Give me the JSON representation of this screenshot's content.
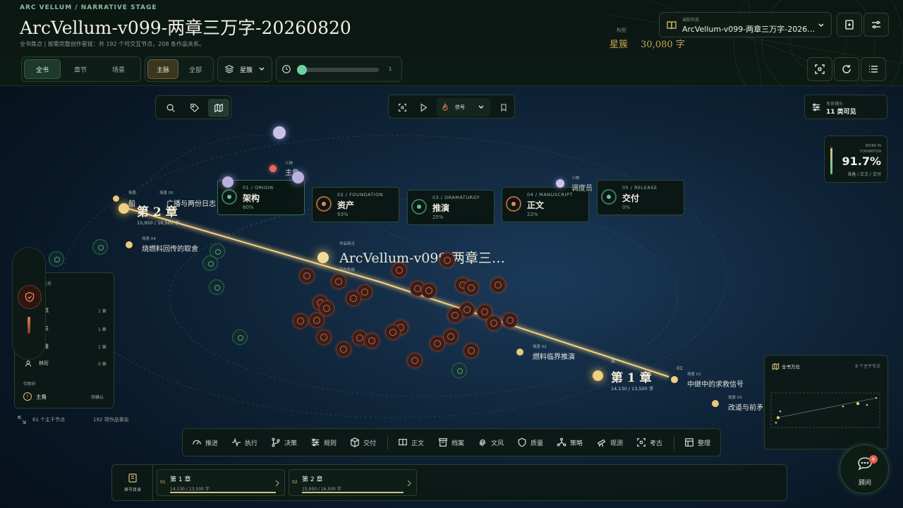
{
  "header": {
    "eyebrow": "ARC VELLUM / NARRATIVE STAGE",
    "title": "ArcVellum-v099-两章三万字-20260820",
    "subtitle": "全书焦点 | 按需完整创作星链：共 192 个可交互节点，208 条作品关系。",
    "scope_tabs": [
      "全书",
      "章节",
      "场景"
    ],
    "scope_active": "全书",
    "line_tabs": [
      "主脉",
      "全部"
    ],
    "line_active": "主脉",
    "layer_label": "星簇",
    "slider_value": "1",
    "meta_label": "构型",
    "meta_value_a": "星簇",
    "meta_value_b": "30,080 字",
    "work_label": "当前作品",
    "work_value": "ArcVellum-v099-两章三万字-2026…"
  },
  "canvas_toolbar": {
    "mode_label": "信号"
  },
  "relations_panel": {
    "label": "关系镜头",
    "value": "11 类可见"
  },
  "formation": {
    "label_a": "WORK IN",
    "label_b": "FORMATION",
    "value": "91.7%",
    "caption": "准备 / 正文 / 交付",
    "progress": 0.917
  },
  "stages": [
    {
      "code": "01 / ORIGIN",
      "name": "架构",
      "pct": "60%"
    },
    {
      "code": "02 / FOUNDATION",
      "name": "资产",
      "pct": "93%"
    },
    {
      "code": "03 / DRAMATURGY",
      "name": "推演",
      "pct": "25%"
    },
    {
      "code": "04 / MANUSCRIPT",
      "name": "正文",
      "pct": "22%"
    },
    {
      "code": "05 / RELEASE",
      "name": "交付",
      "pct": "0%"
    }
  ],
  "graph": {
    "work_tag": "作品原点",
    "work_name": "ArcVellum-v099-两章三…",
    "work_status": "正在形成",
    "protagonist_tag": "人物",
    "protagonist": "主角",
    "dispatcher_tag": "人物",
    "dispatcher": "调度员",
    "ch2_tag_a": "场景",
    "ch2_tag_b": "场景 05",
    "ch2_scene_a": "船",
    "ch2_scene_b": "广播与两份日志",
    "chapter2": "第 2 章",
    "chapter2_words": "15,950 / 16,500 字",
    "scene04_tag": "场景 04",
    "scene04": "烧燃料回传的取舍",
    "scene02_tag": "场景 02",
    "scene02": "燃料临界推演",
    "ch1_tag": "章",
    "chapter1": "第 1 章",
    "chapter1_words": "14,130 / 13,500 字",
    "ch1_num": "01",
    "scene01_tag": "场景 01",
    "scene01": "中继中的求救信号",
    "scene03_tag": "场景 03",
    "scene03": "改道与前矛"
  },
  "left_panel": {
    "header": "任务",
    "rows": [
      {
        "name": "…戎",
        "count": "1 章"
      },
      {
        "name": "…员",
        "count": "1 章"
      },
      {
        "name": "线隆",
        "count": "1 章"
      },
      {
        "name": "林珩",
        "count": "0 章"
      }
    ],
    "section": "待解析",
    "pending_name": "主角",
    "pending_status": "待确认"
  },
  "stats": {
    "nodes": "61 个主干节点",
    "facts": "192 项作品事实"
  },
  "bottom_toolbar": [
    "推进",
    "执行",
    "决策",
    "规则",
    "交付",
    "正文",
    "档案",
    "文风",
    "质量",
    "策略",
    "观测",
    "考古",
    "整理"
  ],
  "chapter_nav": {
    "label": "章节目录",
    "chapters": [
      {
        "num": "01",
        "name": "第 1 章",
        "words": "14,130 / 13,500 字"
      },
      {
        "num": "02",
        "name": "第 2 章",
        "words": "15,950 / 16,500 字"
      }
    ]
  },
  "minimap": {
    "title": "全书方位",
    "count": "8 个主干节点"
  },
  "advisor": {
    "label": "顾问",
    "badge": "8"
  },
  "colors": {
    "accent_green": "#5fc98d",
    "accent_gold": "#e8c36a",
    "node_red": "#c96a45"
  }
}
